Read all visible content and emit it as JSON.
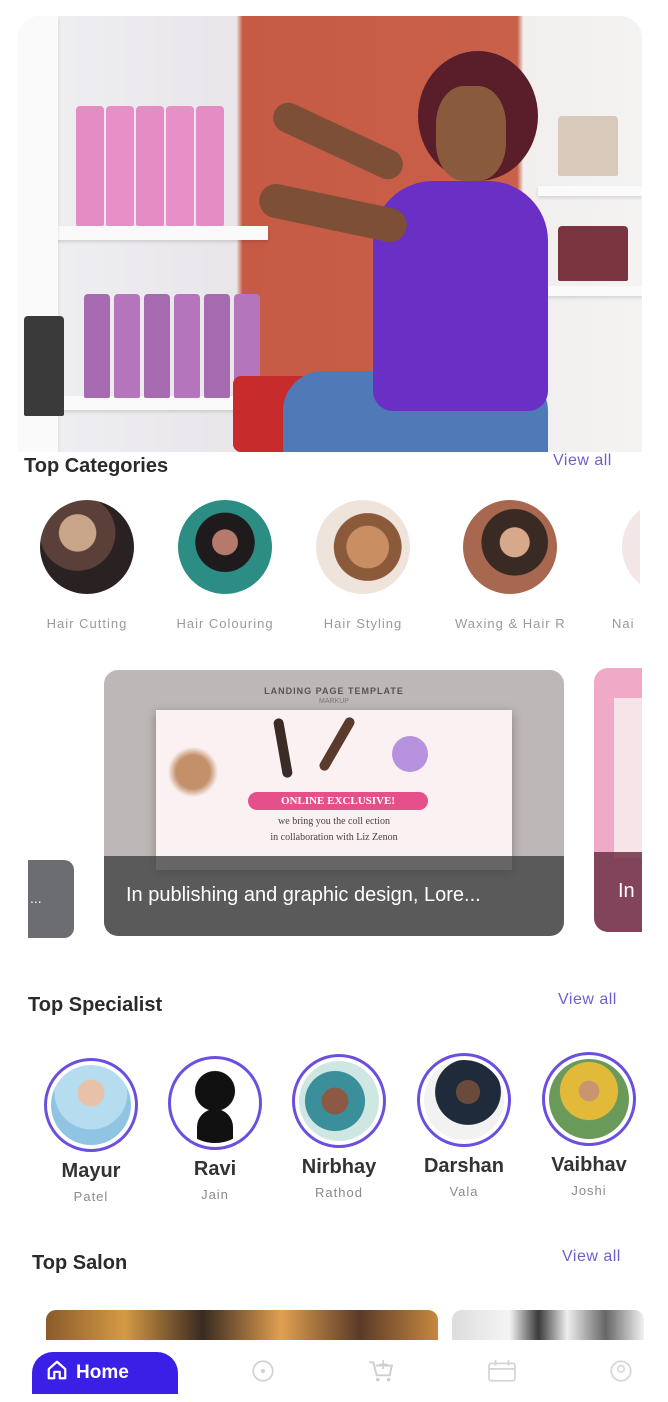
{
  "categories": {
    "title": "Top Categories",
    "view_all": "View all",
    "items": [
      {
        "label": "Hair Cutting"
      },
      {
        "label": "Hair Colouring"
      },
      {
        "label": "Hair Styling"
      },
      {
        "label": "Waxing & Hair R..."
      },
      {
        "label": "Nai"
      }
    ]
  },
  "banners": [
    {
      "caption": "..."
    },
    {
      "caption": "In publishing and graphic design, Lore...",
      "image_text": {
        "header": "LANDING PAGE TEMPLATE",
        "sub": "MARKUP",
        "badge": "ONLINE EXCLUSIVE!",
        "line1": "we bring you the coll ection",
        "line2": "in collaboration with Liz Zenon"
      }
    },
    {
      "caption": "In"
    }
  ],
  "specialists": {
    "title": "Top Specialist",
    "view_all": "View all",
    "items": [
      {
        "name": "Mayur",
        "surname": "Patel"
      },
      {
        "name": "Ravi",
        "surname": "Jain"
      },
      {
        "name": "Nirbhay",
        "surname": "Rathod"
      },
      {
        "name": "Darshan",
        "surname": "Vala"
      },
      {
        "name": "Vaibhav",
        "surname": "Joshi"
      }
    ]
  },
  "salons": {
    "title": "Top Salon",
    "view_all": "View all"
  },
  "nav": {
    "home_label": "Home",
    "icons": [
      "home-icon",
      "compass-icon",
      "cart-icon",
      "calendar-icon",
      "profile-icon"
    ]
  },
  "colors": {
    "accent": "#6a4fe0",
    "nav_active": "#3a1fe6",
    "view_all": "#6e5fd0"
  }
}
